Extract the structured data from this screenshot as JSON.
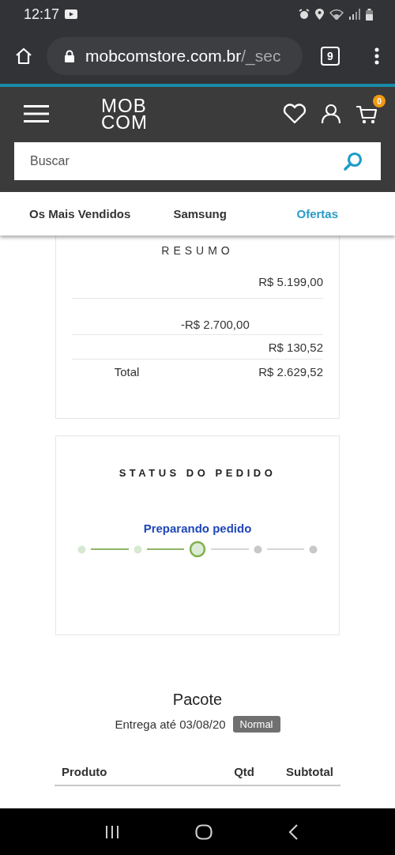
{
  "status_bar": {
    "time": "12:17"
  },
  "browser": {
    "url_host": "mobcomstore.com.br",
    "url_path": "/_sec",
    "tab_count": "9"
  },
  "header": {
    "logo_top": "MOB",
    "logo_bottom": "COM",
    "cart_count": "0"
  },
  "search": {
    "placeholder": "Buscar"
  },
  "nav": [
    {
      "label": "Os Mais Vendidos",
      "selected": false
    },
    {
      "label": "Samsung",
      "selected": false
    },
    {
      "label": "Ofertas",
      "selected": true
    }
  ],
  "summary": {
    "title": "RESUMO",
    "rows": [
      {
        "column_3": "R$ 5.199,00"
      },
      {
        "column_2": "-R$ 2.700,00"
      },
      {
        "column_3": "R$ 130,52"
      },
      {
        "column_1": "Total",
        "column_3": "R$ 2.629,52"
      }
    ]
  },
  "order_status": {
    "title": "STATUS DO PEDIDO",
    "current_label": "Preparando pedido",
    "steps": [
      {
        "done": true,
        "current": false
      },
      {
        "done": true,
        "current": false
      },
      {
        "done": false,
        "current": true
      },
      {
        "done": false,
        "current": false
      },
      {
        "done": false,
        "current": false
      }
    ]
  },
  "package": {
    "title": "Pacote",
    "delivery": "Entrega até 03/08/20",
    "badge": "Normal",
    "columns": [
      "Produto",
      "Qtd",
      "Subtotal"
    ]
  }
}
